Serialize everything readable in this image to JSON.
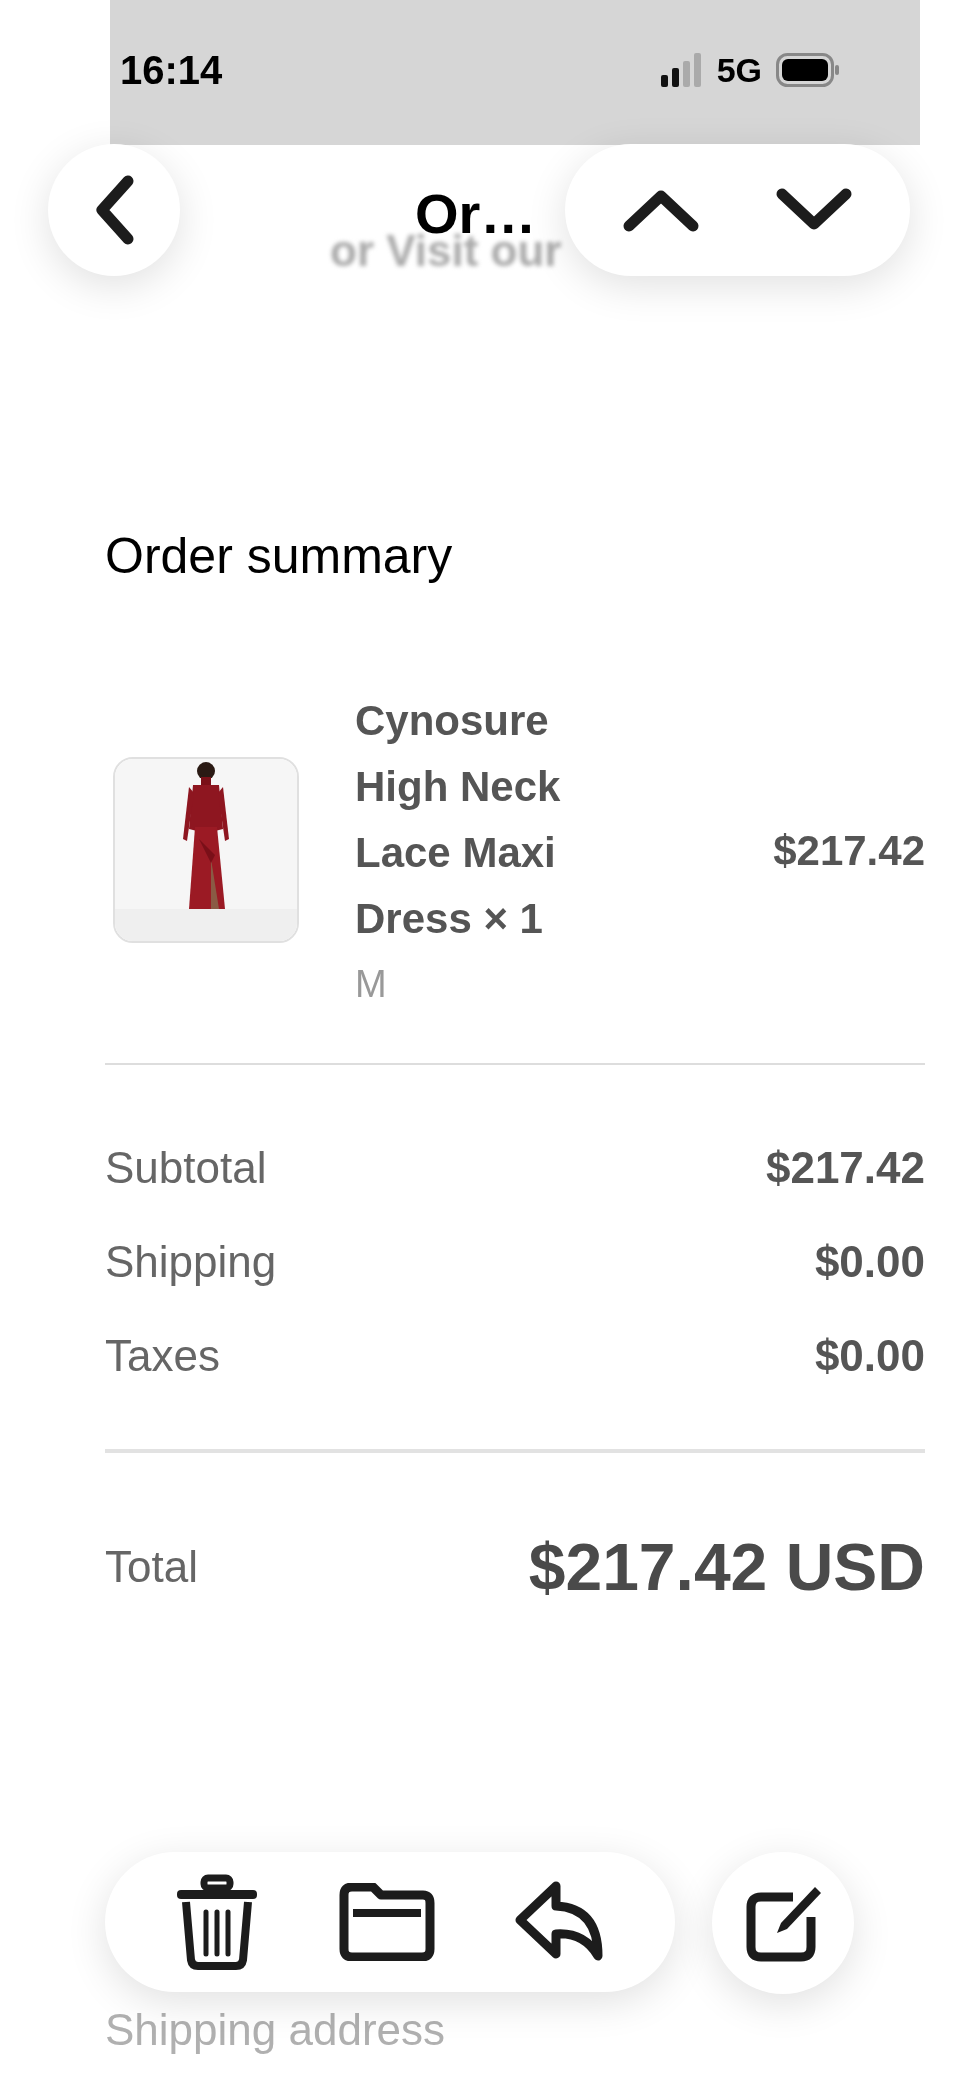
{
  "status_bar": {
    "time": "16:14",
    "network": "5G"
  },
  "nav": {
    "title": "Or…"
  },
  "background_link_text": "or Visit our",
  "order_summary": {
    "heading": "Order summary",
    "items": [
      {
        "name": "Cynosure High Neck Lace Maxi Dress × 1",
        "variant": "M",
        "price": "$217.42"
      }
    ],
    "lines": [
      {
        "label": "Subtotal",
        "value": "$217.42"
      },
      {
        "label": "Shipping",
        "value": "$0.00"
      },
      {
        "label": "Taxes",
        "value": "$0.00"
      }
    ],
    "total": {
      "label": "Total",
      "value": "$217.42 USD"
    }
  },
  "customer_information": {
    "shipping_address_label": "Shipping address"
  }
}
